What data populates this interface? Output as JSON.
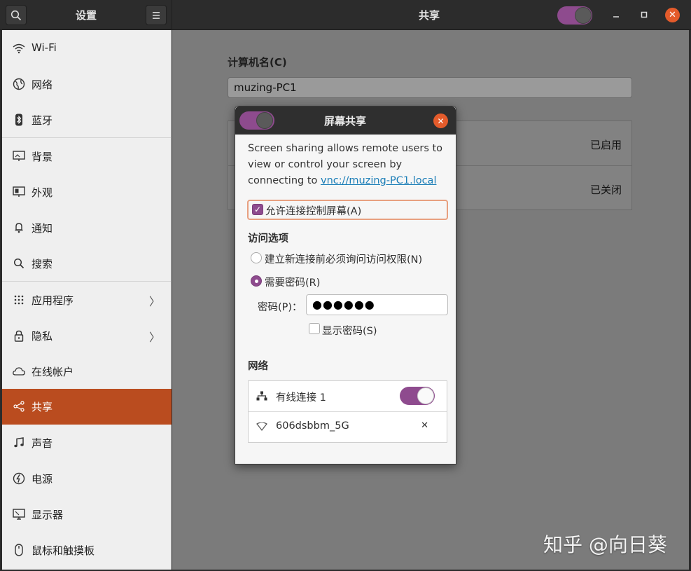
{
  "header": {
    "sidebar_title": "设置",
    "page_title": "共享"
  },
  "sidebar": {
    "items": [
      {
        "label": "Wi-Fi",
        "icon": "wifi-icon"
      },
      {
        "label": "网络",
        "icon": "network-globe-icon"
      },
      {
        "label": "蓝牙",
        "icon": "bluetooth-icon"
      },
      {
        "label": "背景",
        "icon": "background-icon"
      },
      {
        "label": "外观",
        "icon": "appearance-icon"
      },
      {
        "label": "通知",
        "icon": "bell-icon"
      },
      {
        "label": "搜索",
        "icon": "search-icon"
      },
      {
        "label": "应用程序",
        "icon": "apps-grid-icon"
      },
      {
        "label": "隐私",
        "icon": "lock-icon"
      },
      {
        "label": "在线帐户",
        "icon": "cloud-icon"
      },
      {
        "label": "共享",
        "icon": "share-icon"
      },
      {
        "label": "声音",
        "icon": "music-note-icon"
      },
      {
        "label": "电源",
        "icon": "power-icon"
      },
      {
        "label": "显示器",
        "icon": "display-icon"
      },
      {
        "label": "鼠标和触摸板",
        "icon": "mouse-icon"
      }
    ],
    "active": "共享",
    "accent_color": "#ba4c1f"
  },
  "main": {
    "computer_name_label": "计算机名(C)",
    "computer_name_value": "muzing-PC1",
    "rows": [
      {
        "status": "已启用"
      },
      {
        "status": "已关闭"
      }
    ]
  },
  "dialog": {
    "title": "屏幕共享",
    "toggle_on": true,
    "description_prefix": "Screen sharing allows remote users to view or control your screen by connecting to ",
    "description_link": "vnc://muzing-PC1.local",
    "allow_control_label": "允许连接控制屏幕(A)",
    "access_options_title": "访问选项",
    "option_ask": "建立新连接前必须询问访问权限(N)",
    "option_password": "需要密码(R)",
    "password_label": "密码(P)：",
    "password_value": "●●●●●●",
    "show_password_label": "显示密码(S)",
    "network_title": "网络",
    "networks": [
      {
        "label": "有线连接 1",
        "icon": "wired-network-icon",
        "enabled": true
      },
      {
        "label": "606dsbbm_5G",
        "icon": "wifi-signal-icon",
        "enabled": false
      }
    ]
  },
  "watermark": "知乎 @向日葵",
  "colors": {
    "toggle_purple": "#8e4b8e",
    "close_orange": "#e45b2b",
    "link_blue": "#1a7db7"
  }
}
